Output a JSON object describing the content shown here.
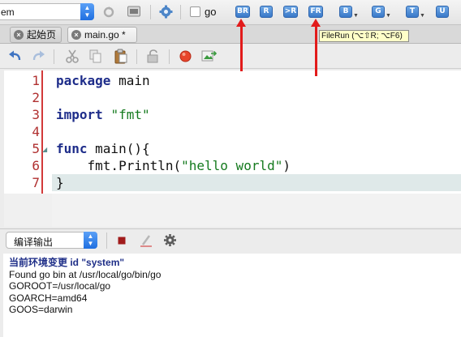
{
  "toolbar": {
    "env_value": "em",
    "env_arrow_up": "▲",
    "env_arrow_down": "▼",
    "checkbox_label": "go",
    "run_buttons": [
      {
        "label": "BR",
        "has_dropdown": false
      },
      {
        "label": "R",
        "has_dropdown": false
      },
      {
        "label": ">R",
        "has_dropdown": false
      },
      {
        "label": "FR",
        "has_dropdown": false
      },
      {
        "label": "B",
        "has_dropdown": true
      },
      {
        "label": "G",
        "has_dropdown": true
      },
      {
        "label": "T",
        "has_dropdown": true
      },
      {
        "label": "U",
        "has_dropdown": false
      }
    ],
    "dropdown_glyph": "▼"
  },
  "tooltip": {
    "text": "FileRun (⌥⇧R; ⌥F6)"
  },
  "tabs": [
    {
      "label": "起始页",
      "close": "×",
      "active": false
    },
    {
      "label": "main.go *",
      "close": "×",
      "active": true
    }
  ],
  "editor": {
    "line_numbers": [
      "1",
      "2",
      "3",
      "4",
      "5",
      "6",
      "7"
    ],
    "fold_marker": "◢",
    "lines": [
      {
        "kw": "package",
        "rest": " main",
        "str": ""
      },
      {
        "kw": "",
        "rest": "",
        "str": ""
      },
      {
        "kw": "import",
        "rest": " ",
        "str": "\"fmt\""
      },
      {
        "kw": "",
        "rest": "",
        "str": ""
      },
      {
        "kw": "func",
        "rest": " main(){",
        "str": ""
      },
      {
        "kw": "",
        "rest": "    fmt.Println(",
        "str": "\"hello world\"",
        "after": ")"
      },
      {
        "kw": "",
        "rest": "}",
        "str": ""
      }
    ],
    "current_line": 7
  },
  "output_panel": {
    "select_value": "编译输出",
    "arrow_up": "▲",
    "arrow_down": "▼",
    "lines": [
      "当前环境变更 id \"system\"",
      "Found go bin at /usr/local/go/bin/go",
      "GOROOT=/usr/local/go",
      "GOARCH=amd64",
      "GOOS=darwin"
    ]
  },
  "colors": {
    "accent": "#1f6fe0",
    "gutter_line": "#d23a3a",
    "keyword": "#1e2d8a",
    "string": "#157a1e",
    "annotation_arrow": "#e21b1b"
  }
}
